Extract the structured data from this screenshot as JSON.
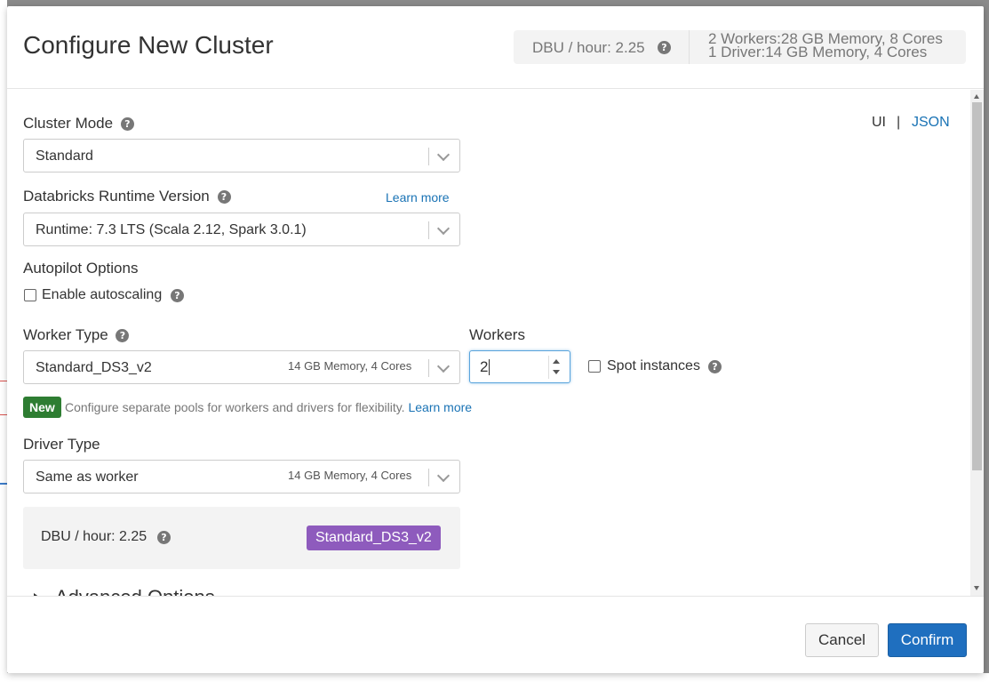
{
  "modal": {
    "title": "Configure New Cluster",
    "summary": {
      "dbu": "DBU / hour: 2.25",
      "workers_line": "2 Workers:28 GB Memory, 8 Cores",
      "driver_line": "1 Driver:14 GB Memory, 4 Cores"
    }
  },
  "view_toggle": {
    "ui": "UI",
    "separator": "|",
    "json": "JSON"
  },
  "cluster_mode": {
    "label": "Cluster Mode",
    "value": "Standard"
  },
  "runtime": {
    "label": "Databricks Runtime Version",
    "learn_more": "Learn more",
    "value": "Runtime: 7.3 LTS (Scala 2.12, Spark 3.0.1)"
  },
  "autopilot": {
    "label": "Autopilot Options",
    "autoscaling_label": "Enable autoscaling",
    "autoscaling_checked": false
  },
  "worker_type": {
    "label": "Worker Type",
    "value": "Standard_DS3_v2",
    "meta": "14 GB Memory, 4 Cores"
  },
  "workers": {
    "label": "Workers",
    "value": "2"
  },
  "spot": {
    "label": "Spot instances",
    "checked": false
  },
  "pools_notice": {
    "badge": "New",
    "text": "Configure separate pools for workers and drivers for flexibility.",
    "learn_more": "Learn more"
  },
  "driver_type": {
    "label": "Driver Type",
    "value": "Same as worker",
    "meta": "14 GB Memory, 4 Cores"
  },
  "dbu_panel": {
    "text": "DBU / hour: 2.25",
    "instance": "Standard_DS3_v2"
  },
  "advanced": {
    "label": "Advanced Options"
  },
  "footer": {
    "cancel": "Cancel",
    "confirm": "Confirm"
  },
  "colors": {
    "primary": "#1f6fbf",
    "badge_green": "#2e7d32",
    "instance_purple": "#8e5bbd",
    "link": "#1a73b5"
  }
}
